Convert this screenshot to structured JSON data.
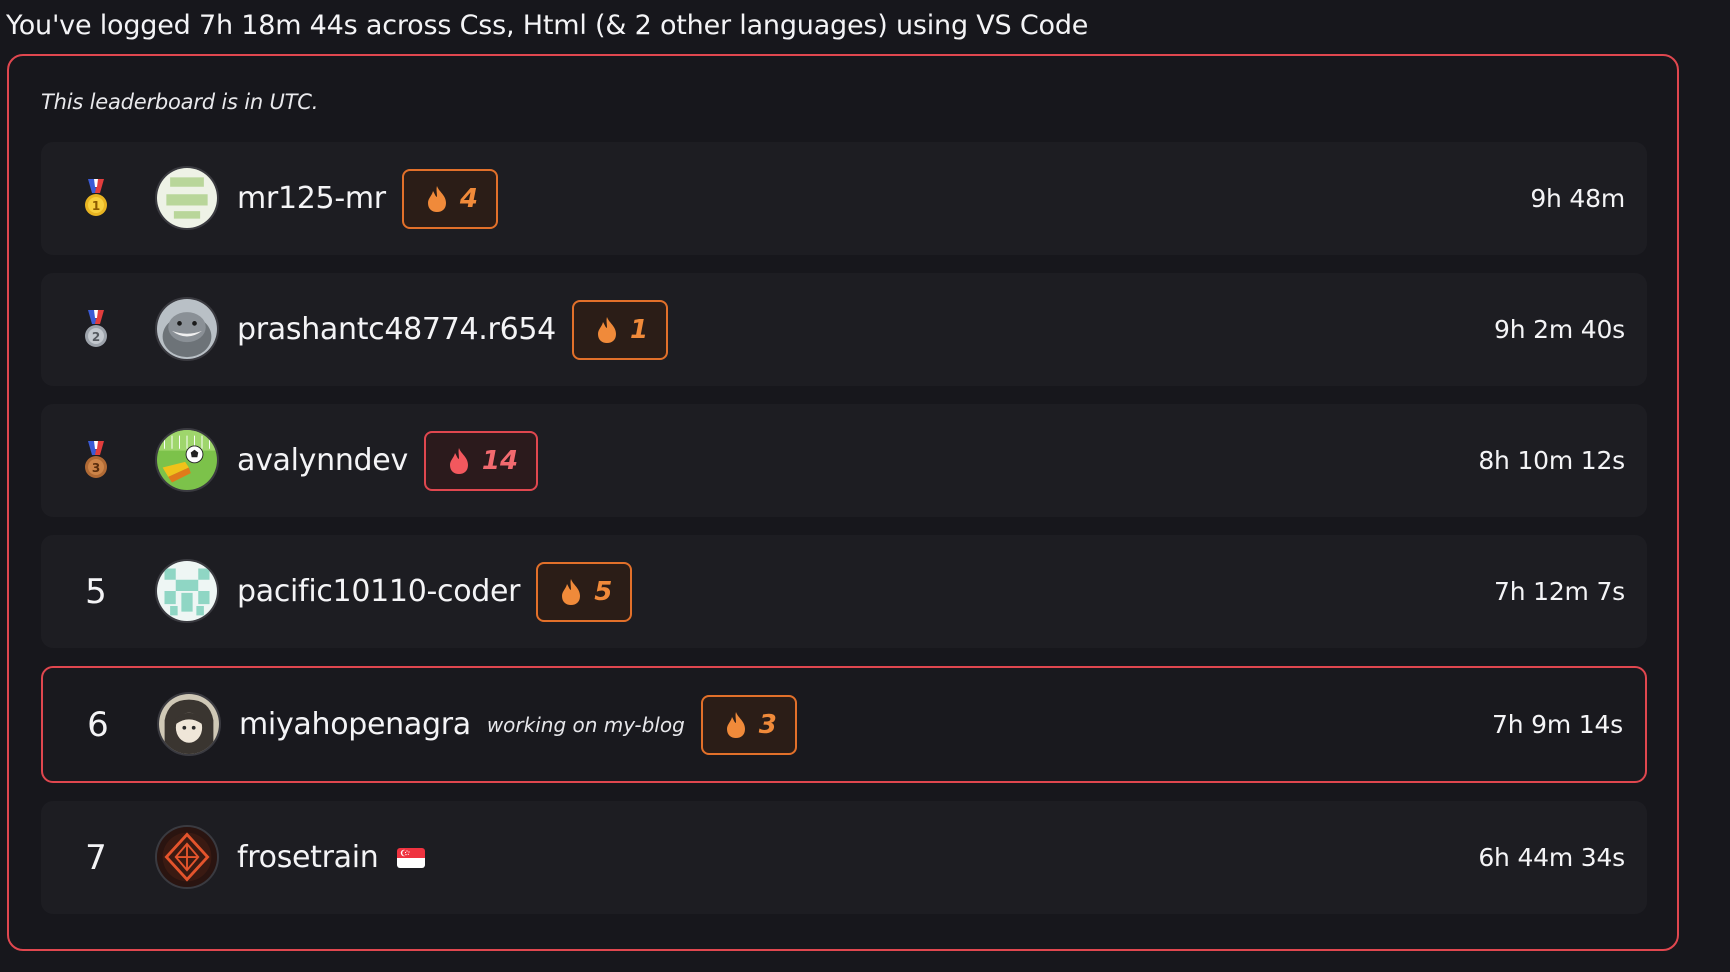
{
  "summary": "You've logged 7h 18m 44s across Css, Html (& 2 other languages) using VS Code",
  "leaderboard": {
    "note": "This leaderboard is in UTC.",
    "rows": [
      {
        "rank": "1",
        "medal": "gold-medal-icon",
        "username": "mr125-mr",
        "streak": "4",
        "time": "9h 48m"
      },
      {
        "rank": "2",
        "medal": "silver-medal-icon",
        "username": "prashantc48774.r654",
        "streak": "1",
        "time": "9h 2m 40s"
      },
      {
        "rank": "3",
        "medal": "bronze-medal-icon",
        "username": "avalynndev",
        "streak": "14",
        "time": "8h 10m 12s"
      },
      {
        "rank": "5",
        "username": "pacific10110-coder",
        "streak": "5",
        "time": "7h 12m 7s"
      },
      {
        "rank": "6",
        "username": "miyahopenagra",
        "status": "working on my-blog",
        "streak": "3",
        "time": "7h 9m 14s",
        "current_user": true
      },
      {
        "rank": "7",
        "username": "frosetrain",
        "flag": "singapore-flag-icon",
        "time": "6h 44m 34s"
      }
    ]
  },
  "colors": {
    "accent": "#e0474f",
    "streak": "#e2702a",
    "background": "#17171c",
    "row": "#1d1d22"
  }
}
